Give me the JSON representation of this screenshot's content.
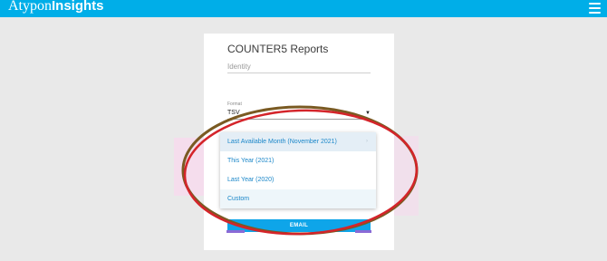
{
  "header": {
    "brand_part1": "Atypon",
    "brand_part2": "Insights",
    "menu_icon": "hamburger-menu-icon",
    "color": "#00aee8"
  },
  "card": {
    "title": "COUNTER5 Reports",
    "identity_placeholder": "Identity",
    "format_label": "Format",
    "format_value": "TSV",
    "email_button": "EMAIL"
  },
  "dropdown": {
    "options": [
      {
        "label": "Last Available Month (November 2021)",
        "selected": true
      },
      {
        "label": "This Year (2021)",
        "selected": false
      },
      {
        "label": "Last Year (2020)",
        "selected": false
      },
      {
        "label": "Custom",
        "selected": false
      }
    ]
  },
  "annotation": {
    "ellipse_color": "#d4242a",
    "ellipse_inner_color": "#7a5a22"
  }
}
